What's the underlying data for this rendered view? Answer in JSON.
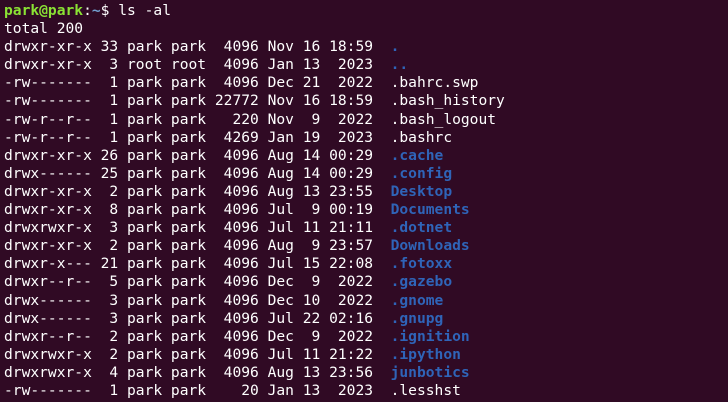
{
  "terminal": {
    "colors": {
      "background": "#300a24",
      "foreground": "#ffffff",
      "prompt_user": "#8ae234",
      "prompt_path": "#729fcf",
      "directory": "#2f64b8"
    },
    "prompt": {
      "user_host": "park@park",
      "colon": ":",
      "path": "~",
      "symbol": "$",
      "command": "ls -al"
    },
    "total_line": "total 200",
    "rows": [
      {
        "meta": "drwxr-xr-x 33 park park  4096 Nov 16 18:59",
        "name": ".",
        "is_dir": true
      },
      {
        "meta": "drwxr-xr-x  3 root root  4096 Jan 13  2023",
        "name": "..",
        "is_dir": true
      },
      {
        "meta": "-rw-------  1 park park  4096 Dec 21  2022",
        "name": ".bahrc.swp",
        "is_dir": false
      },
      {
        "meta": "-rw-------  1 park park 22772 Nov 16 18:59",
        "name": ".bash_history",
        "is_dir": false
      },
      {
        "meta": "-rw-r--r--  1 park park   220 Nov  9  2022",
        "name": ".bash_logout",
        "is_dir": false
      },
      {
        "meta": "-rw-r--r--  1 park park  4269 Jan 19  2023",
        "name": ".bashrc",
        "is_dir": false
      },
      {
        "meta": "drwxr-xr-x 26 park park  4096 Aug 14 00:29",
        "name": ".cache",
        "is_dir": true
      },
      {
        "meta": "drwx------ 25 park park  4096 Aug 14 00:29",
        "name": ".config",
        "is_dir": true
      },
      {
        "meta": "drwxr-xr-x  2 park park  4096 Aug 13 23:55",
        "name": "Desktop",
        "is_dir": true
      },
      {
        "meta": "drwxr-xr-x  8 park park  4096 Jul  9 00:19",
        "name": "Documents",
        "is_dir": true
      },
      {
        "meta": "drwxrwxr-x  3 park park  4096 Jul 11 21:11",
        "name": ".dotnet",
        "is_dir": true
      },
      {
        "meta": "drwxr-xr-x  2 park park  4096 Aug  9 23:57",
        "name": "Downloads",
        "is_dir": true
      },
      {
        "meta": "drwxr-x--- 21 park park  4096 Jul 15 22:08",
        "name": ".fotoxx",
        "is_dir": true
      },
      {
        "meta": "drwxr--r--  5 park park  4096 Dec  9  2022",
        "name": ".gazebo",
        "is_dir": true
      },
      {
        "meta": "drwx------  3 park park  4096 Dec 10  2022",
        "name": ".gnome",
        "is_dir": true
      },
      {
        "meta": "drwx------  3 park park  4096 Jul 22 02:16",
        "name": ".gnupg",
        "is_dir": true
      },
      {
        "meta": "drwxr--r--  2 park park  4096 Dec  9  2022",
        "name": ".ignition",
        "is_dir": true
      },
      {
        "meta": "drwxrwxr-x  2 park park  4096 Jul 11 21:22",
        "name": ".ipython",
        "is_dir": true
      },
      {
        "meta": "drwxrwxr-x  4 park park  4096 Aug 13 23:56",
        "name": "junbotics",
        "is_dir": true
      },
      {
        "meta": "-rw-------  1 park park    20 Jan 13  2023",
        "name": ".lesshst",
        "is_dir": false
      }
    ]
  }
}
